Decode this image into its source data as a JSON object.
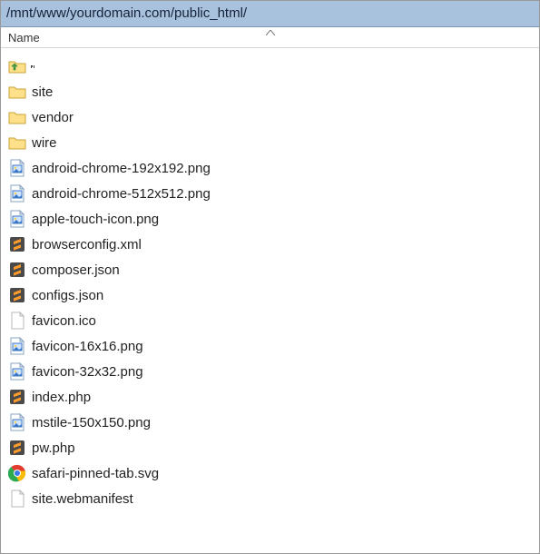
{
  "path": "/mnt/www/yourdomain.com/public_html/",
  "columns": {
    "name": "Name"
  },
  "items": [
    {
      "icon": "folder-up",
      "name": "",
      "interactable": true,
      "focused": true
    },
    {
      "icon": "folder",
      "name": "site",
      "interactable": true
    },
    {
      "icon": "folder",
      "name": "vendor",
      "interactable": true
    },
    {
      "icon": "folder",
      "name": "wire",
      "interactable": true
    },
    {
      "icon": "image-file",
      "name": "android-chrome-192x192.png",
      "interactable": true
    },
    {
      "icon": "image-file",
      "name": "android-chrome-512x512.png",
      "interactable": true
    },
    {
      "icon": "image-file",
      "name": "apple-touch-icon.png",
      "interactable": true
    },
    {
      "icon": "sublime-file",
      "name": "browserconfig.xml",
      "interactable": true
    },
    {
      "icon": "sublime-file",
      "name": "composer.json",
      "interactable": true
    },
    {
      "icon": "sublime-file",
      "name": "configs.json",
      "interactable": true
    },
    {
      "icon": "blank-file",
      "name": "favicon.ico",
      "interactable": true
    },
    {
      "icon": "image-file",
      "name": "favicon-16x16.png",
      "interactable": true
    },
    {
      "icon": "image-file",
      "name": "favicon-32x32.png",
      "interactable": true
    },
    {
      "icon": "sublime-file",
      "name": "index.php",
      "interactable": true
    },
    {
      "icon": "image-file",
      "name": "mstile-150x150.png",
      "interactable": true
    },
    {
      "icon": "sublime-file",
      "name": "pw.php",
      "interactable": true
    },
    {
      "icon": "chrome-file",
      "name": "safari-pinned-tab.svg",
      "interactable": true
    },
    {
      "icon": "blank-file",
      "name": "site.webmanifest",
      "interactable": true
    }
  ]
}
